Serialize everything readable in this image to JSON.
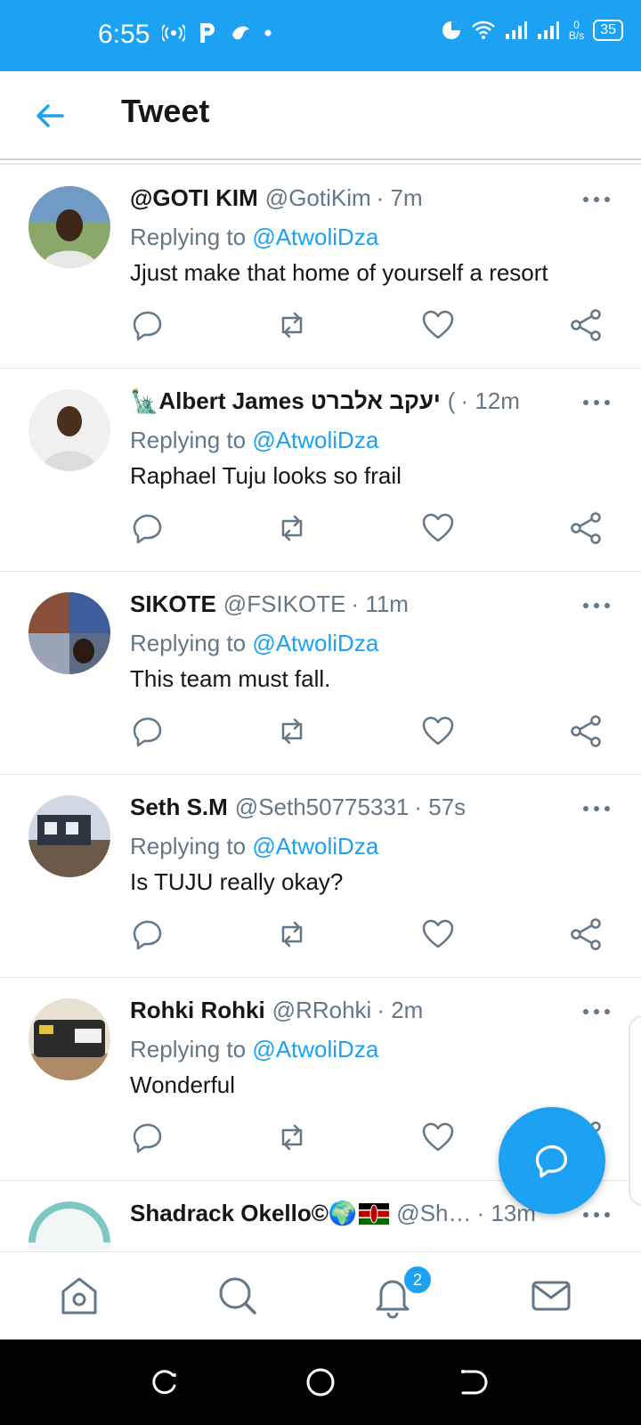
{
  "status_bar": {
    "time": "6:55",
    "speed_value": "0",
    "speed_unit": "B/s",
    "battery": "35"
  },
  "header": {
    "title": "Tweet"
  },
  "tweets": [
    {
      "name": "@GOTI KIM",
      "handle": "@GotiKim",
      "time": "· 7m",
      "reply_prefix": "Replying to",
      "reply_to": "@AtwoliDza",
      "text": "Jjust make that home of yourself a resort"
    },
    {
      "name": "Albert James יעקב אלברט",
      "handle": "( ",
      "time": "· 12m",
      "reply_prefix": "Replying to",
      "reply_to": "@AtwoliDza",
      "text": "Raphael Tuju looks so frail",
      "name_emoji": "🗽"
    },
    {
      "name": "SIKOTE",
      "handle": "@FSIKOTE",
      "time": "· 11m",
      "reply_prefix": "Replying to",
      "reply_to": "@AtwoliDza",
      "text": "This team must fall."
    },
    {
      "name": "Seth S.M",
      "handle": "@Seth50775331",
      "time": "· 57s",
      "reply_prefix": "Replying to",
      "reply_to": "@AtwoliDza",
      "text": "Is TUJU really okay?"
    },
    {
      "name": "Rohki Rohki",
      "handle": "@RRohki",
      "time": "· 2m",
      "reply_prefix": "Replying to",
      "reply_to": "@AtwoliDza",
      "text": "Wonderful"
    },
    {
      "name": "Shadrack Okello©",
      "handle": "@Sh…",
      "time": "· 13m",
      "name_emoji": "🌍"
    }
  ],
  "bottom_nav": {
    "notifications_badge": "2"
  },
  "icons": {
    "back": "arrow-left-icon",
    "more": "more-horizontal-icon",
    "reply": "reply-icon",
    "retweet": "retweet-icon",
    "like": "heart-icon",
    "share": "share-icon",
    "compose": "compose-reply-icon",
    "home": "home-icon",
    "search": "search-icon",
    "notifications": "bell-icon",
    "messages": "mail-icon"
  },
  "colors": {
    "accent": "#1da1f2",
    "secondary_text": "#657786",
    "primary_text": "#14171a"
  }
}
